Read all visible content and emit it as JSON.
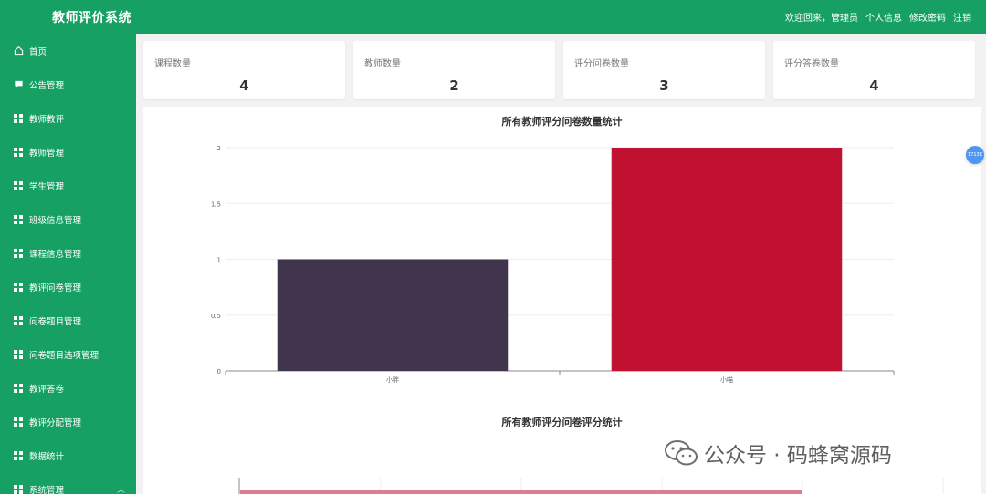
{
  "header": {
    "title": "教师评价系统",
    "welcome": "欢迎回来，管理员",
    "profile": "个人信息",
    "change_password": "修改密码",
    "logout": "注销"
  },
  "sidebar": {
    "items": [
      {
        "label": "首页",
        "icon": "home-icon"
      },
      {
        "label": "公告管理",
        "icon": "message-icon"
      },
      {
        "label": "教师教评",
        "icon": "grid-icon"
      },
      {
        "label": "教师管理",
        "icon": "grid-icon"
      },
      {
        "label": "学生管理",
        "icon": "grid-icon"
      },
      {
        "label": "班级信息管理",
        "icon": "grid-icon"
      },
      {
        "label": "课程信息管理",
        "icon": "grid-icon"
      },
      {
        "label": "教评问卷管理",
        "icon": "grid-icon"
      },
      {
        "label": "问卷题目管理",
        "icon": "grid-icon"
      },
      {
        "label": "问卷题目选项管理",
        "icon": "grid-icon"
      },
      {
        "label": "教评答卷",
        "icon": "grid-icon"
      },
      {
        "label": "教评分配管理",
        "icon": "grid-icon"
      },
      {
        "label": "数据统计",
        "icon": "grid-icon"
      },
      {
        "label": "系统管理",
        "icon": "grid-icon"
      }
    ]
  },
  "stats": [
    {
      "label": "课程数量",
      "value": "4"
    },
    {
      "label": "教师数量",
      "value": "2"
    },
    {
      "label": "评分问卷数量",
      "value": "3"
    },
    {
      "label": "评分答卷数量",
      "value": "4"
    }
  ],
  "float_button": {
    "text": "1713K"
  },
  "watermark": {
    "text": "公众号 · 码蜂窝源码"
  },
  "chart_data": [
    {
      "type": "bar",
      "title": "所有教师评分问卷数量统计",
      "categories": [
        "小胖",
        "小喵"
      ],
      "values": [
        1,
        2
      ],
      "colors": [
        "#41344d",
        "#c11133"
      ],
      "yticks": [
        "0",
        "0.5",
        "1",
        "1.5",
        "2"
      ],
      "ylim": [
        0,
        2
      ],
      "grid": true
    },
    {
      "type": "bar",
      "title": "所有教师评分问卷评分统计",
      "colors": [
        "#e07b95"
      ]
    }
  ]
}
